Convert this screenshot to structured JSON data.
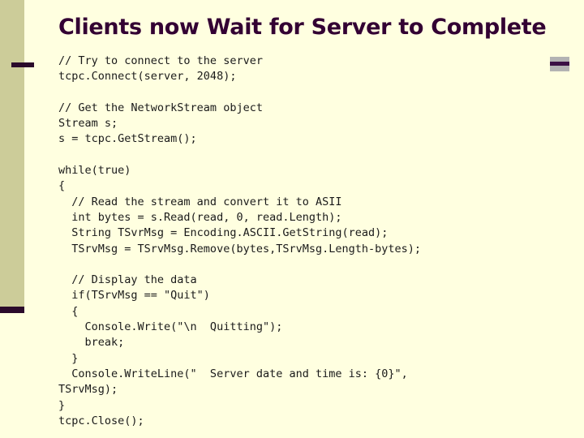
{
  "slide": {
    "title": "Clients now Wait for Server to Complete",
    "background_color": "#ffffe0",
    "accent_color": "#cccc99",
    "title_color": "#330033",
    "code_color": "#1a1a1a",
    "corner_mark_color": "#b3b3b3",
    "corner_mark_stripe_color": "#3b1045",
    "accent_cap_color": "#2b0a2b"
  },
  "code": {
    "lines": [
      "// Try to connect to the server",
      "tcpc.Connect(server, 2048);",
      "",
      "// Get the NetworkStream object",
      "Stream s;",
      "s = tcpc.GetStream();",
      "",
      "while(true)",
      "{",
      "  // Read the stream and convert it to ASII",
      "  int bytes = s.Read(read, 0, read.Length);",
      "  String TSvrMsg = Encoding.ASCII.GetString(read);",
      "  TSrvMsg = TSrvMsg.Remove(bytes,TSrvMsg.Length-bytes);",
      "",
      "  // Display the data",
      "  if(TSrvMsg == \"Quit\")",
      "  {",
      "    Console.Write(\"\\n  Quitting\");",
      "    break;",
      "  }",
      "  Console.WriteLine(\"  Server date and time is: {0}\",",
      "TSrvMsg);",
      "}",
      "tcpc.Close();"
    ]
  }
}
